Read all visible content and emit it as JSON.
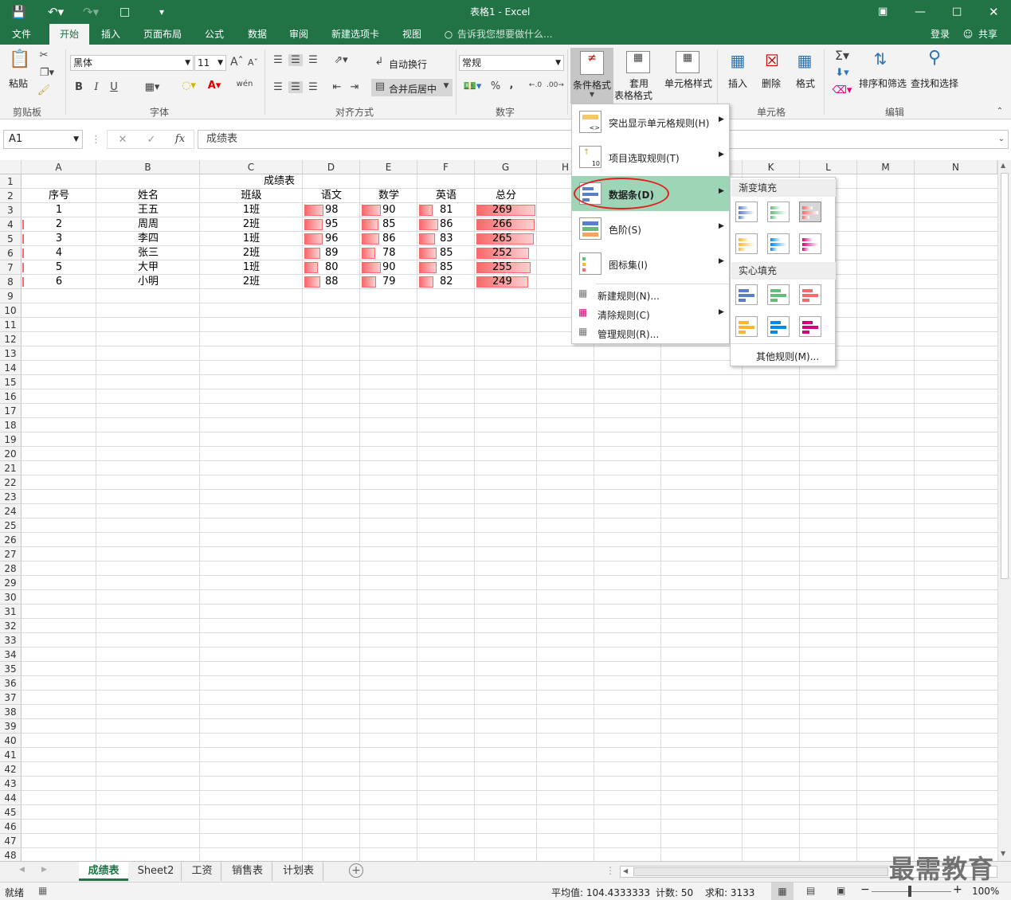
{
  "window": {
    "title": "表格1 - Excel"
  },
  "tabs": [
    "文件",
    "开始",
    "插入",
    "页面布局",
    "公式",
    "数据",
    "审阅",
    "新建选项卡",
    "视图"
  ],
  "tell_me": "告诉我您想要做什么...",
  "account": {
    "login": "登录",
    "share": "共享"
  },
  "ribbon": {
    "clipboard": {
      "paste": "粘贴",
      "group": "剪贴板"
    },
    "font": {
      "name": "黑体",
      "size": "11",
      "group": "字体",
      "bold": "B",
      "italic": "I",
      "underline": "U"
    },
    "alignment": {
      "wrap": "自动换行",
      "merge": "合并后居中",
      "group": "对齐方式"
    },
    "number": {
      "format": "常规",
      "group": "数字",
      "percent": "%",
      "comma": ","
    },
    "styles": {
      "conditional": "条件格式",
      "table_line1": "套用",
      "table_line2": "表格格式",
      "cell_styles": "单元格样式"
    },
    "cells": {
      "insert": "插入",
      "delete": "删除",
      "format": "格式",
      "group": "单元格"
    },
    "editing": {
      "sort": "排序和筛选",
      "find": "查找和选择",
      "group": "编辑"
    }
  },
  "formula_bar": {
    "name_box": "A1",
    "fx": "fx",
    "content": "成绩表"
  },
  "columns": [
    "A",
    "B",
    "C",
    "D",
    "E",
    "F",
    "G",
    "H",
    "I",
    "J",
    "K",
    "L",
    "M",
    "N"
  ],
  "rows": [
    "1",
    "2",
    "3",
    "4",
    "5",
    "6",
    "7",
    "8",
    "9",
    "10",
    "11",
    "12",
    "13",
    "14",
    "15",
    "16",
    "17",
    "18",
    "19",
    "20",
    "21",
    "22",
    "23",
    "24",
    "25",
    "26",
    "27",
    "28",
    "29",
    "30",
    "31",
    "32",
    "33",
    "34",
    "35",
    "36",
    "37",
    "38",
    "39",
    "40",
    "41",
    "42",
    "43",
    "44",
    "45",
    "46",
    "47",
    "48"
  ],
  "sheet": {
    "title": "成绩表",
    "headers": [
      "序号",
      "姓名",
      "班级",
      "语文",
      "数学",
      "英语",
      "总分"
    ],
    "data": [
      [
        "1",
        "王五",
        "1班",
        "98",
        "90",
        "81",
        "269"
      ],
      [
        "2",
        "周周",
        "2班",
        "95",
        "85",
        "86",
        "266"
      ],
      [
        "3",
        "李四",
        "1班",
        "96",
        "86",
        "83",
        "265"
      ],
      [
        "4",
        "张三",
        "2班",
        "89",
        "78",
        "85",
        "252"
      ],
      [
        "5",
        "大甲",
        "1班",
        "80",
        "90",
        "85",
        "255"
      ],
      [
        "6",
        "小明",
        "2班",
        "88",
        "79",
        "82",
        "249"
      ]
    ]
  },
  "menu": {
    "items": [
      "突出显示单元格规则(H)",
      "项目选取规则(T)",
      "数据条(D)",
      "色阶(S)",
      "图标集(I)"
    ],
    "actions": [
      "新建规则(N)...",
      "清除规则(C)",
      "管理规则(R)..."
    ]
  },
  "submenu": {
    "gradient": "渐变填充",
    "solid": "实心填充",
    "more": "其他规则(M)..."
  },
  "databar_colors": [
    "#5b7fc4",
    "#63be7b",
    "#f8696b",
    "#ffb628",
    "#008aef",
    "#d6007b"
  ],
  "sheet_tabs": [
    "成绩表",
    "Sheet2",
    "工资",
    "销售表",
    "计划表"
  ],
  "status": {
    "ready": "就绪",
    "average": "平均值: 104.4333333",
    "count": "计数: 50",
    "sum": "求和: 3133",
    "zoom": "100%"
  },
  "watermark": "最需教育"
}
